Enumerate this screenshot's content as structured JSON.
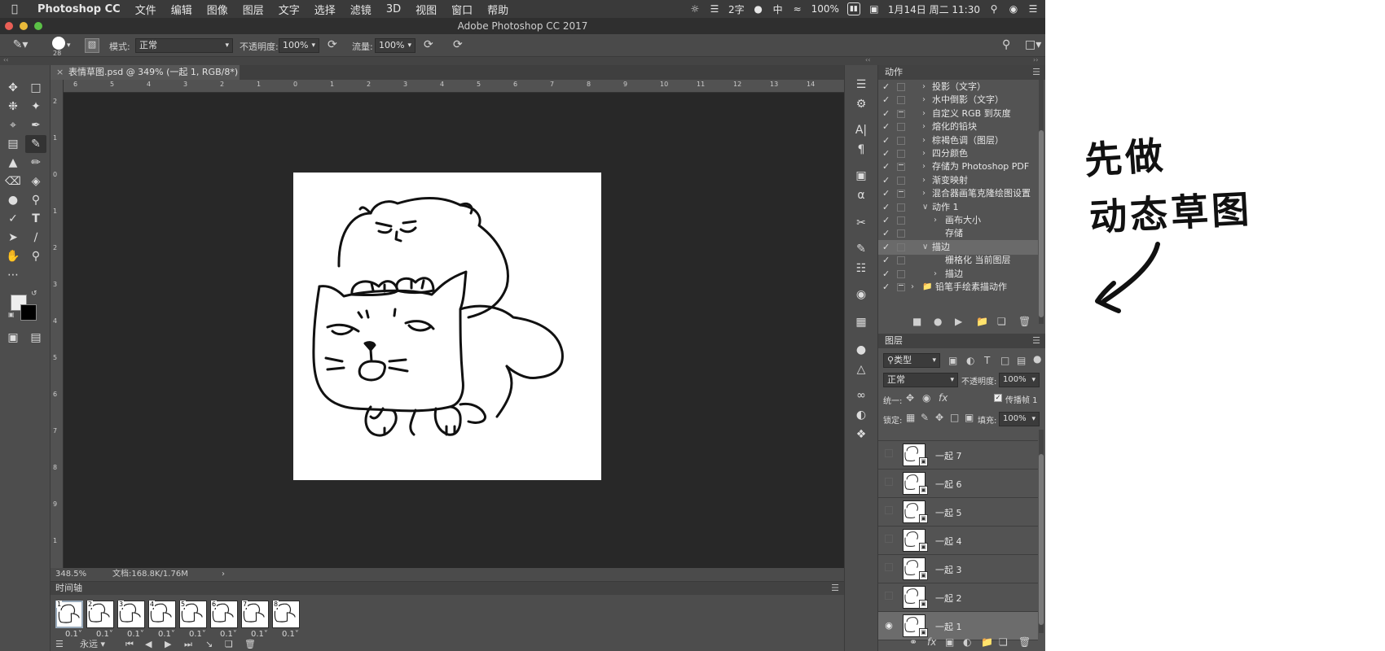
{
  "menubar": {
    "app_name": "Photoshop CC",
    "menus": [
      "文件",
      "编辑",
      "图像",
      "图层",
      "文字",
      "选择",
      "滤镜",
      "3D",
      "视图",
      "窗口",
      "帮助"
    ],
    "status": {
      "input_label": "2字",
      "ime": "中",
      "battery": "100%",
      "datetime": "1月14日 周二 11:30"
    }
  },
  "window": {
    "title": "Adobe Photoshop CC 2017"
  },
  "options": {
    "brush_size": "28",
    "mode_label": "模式:",
    "mode_value": "正常",
    "opacity_label": "不透明度:",
    "opacity_value": "100%",
    "flow_label": "流量:",
    "flow_value": "100%"
  },
  "document": {
    "tab_title": "表情草图.psd @ 349% (一起 1, RGB/8*) *",
    "ruler_top": [
      "6",
      "5",
      "4",
      "3",
      "2",
      "1",
      "0",
      "1",
      "2",
      "3",
      "4",
      "5",
      "6",
      "7",
      "8",
      "9",
      "10",
      "11",
      "12",
      "13",
      "14"
    ],
    "ruler_left": [
      "2",
      "1",
      "0",
      "1",
      "2",
      "3",
      "4",
      "5",
      "6",
      "7",
      "8",
      "9",
      "1"
    ],
    "zoom": "348.5%",
    "doc_info": "文档:168.8K/1.76M"
  },
  "timeline": {
    "title": "时间轴",
    "frames": [
      {
        "num": "1",
        "delay": "0.1"
      },
      {
        "num": "2",
        "delay": "0.1"
      },
      {
        "num": "3",
        "delay": "0.1"
      },
      {
        "num": "4",
        "delay": "0.1"
      },
      {
        "num": "5",
        "delay": "0.1"
      },
      {
        "num": "6",
        "delay": "0.1"
      },
      {
        "num": "7",
        "delay": "0.1"
      },
      {
        "num": "8",
        "delay": "0.1"
      }
    ],
    "loop": "永远"
  },
  "actions": {
    "title": "动作",
    "rows": [
      {
        "label": "投影（文字）"
      },
      {
        "label": "水中倒影（文字）"
      },
      {
        "label": "自定义 RGB 到灰度"
      },
      {
        "label": "熔化的铅块"
      },
      {
        "label": "棕褐色调（图层）"
      },
      {
        "label": "四分颜色"
      },
      {
        "label": "存储为 Photoshop PDF"
      },
      {
        "label": "渐变映射"
      },
      {
        "label": "混合器画笔克隆绘图设置"
      },
      {
        "label": "动作 1"
      },
      {
        "label": "画布大小"
      },
      {
        "label": "存储"
      },
      {
        "label": "描边"
      },
      {
        "label": "栅格化 当前图层"
      },
      {
        "label": "描边"
      },
      {
        "label": "铅笔手绘素描动作"
      }
    ]
  },
  "layers": {
    "title": "图层",
    "filter_kind": "类型",
    "blend_mode": "正常",
    "opacity_label": "不透明度:",
    "opacity_value": "100%",
    "unify_label": "统一:",
    "propagate_label": "传播帧 1",
    "lock_label": "锁定:",
    "fill_label": "填充:",
    "fill_value": "100%",
    "rows": [
      {
        "name": "一起 7"
      },
      {
        "name": "一起 6"
      },
      {
        "name": "一起 5"
      },
      {
        "name": "一起 4"
      },
      {
        "name": "一起 3"
      },
      {
        "name": "一起 2"
      },
      {
        "name": "一起 1"
      }
    ]
  },
  "note": {
    "line1": "先做",
    "line2": "动态草图"
  }
}
